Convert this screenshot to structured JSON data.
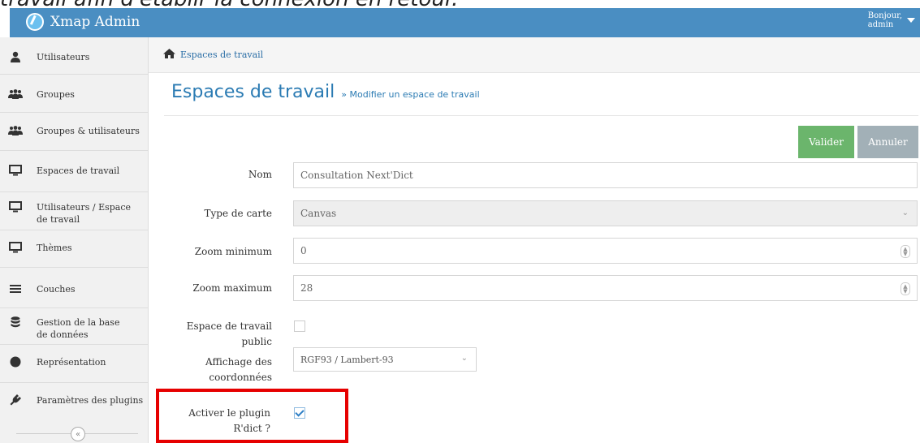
{
  "caption": "travail afin d'établir la connexion en retour.",
  "navbar": {
    "brand": "Xmap Admin",
    "user_greeting": "Bonjour,",
    "user_name": "admin"
  },
  "sidebar": {
    "items": [
      {
        "label": "Utilisateurs",
        "icon": "user-icon"
      },
      {
        "label": "Groupes",
        "icon": "group-icon"
      },
      {
        "label": "Groupes & utilisateurs",
        "icon": "group-icon"
      },
      {
        "label": "Espaces de travail",
        "icon": "monitor-icon"
      },
      {
        "label": "Utilisateurs / Espace de travail",
        "icon": "monitor-icon"
      },
      {
        "label": "Thèmes",
        "icon": "monitor-icon"
      },
      {
        "label": "Couches",
        "icon": "bars-icon"
      },
      {
        "label": "Gestion de la base de données",
        "icon": "database-icon"
      },
      {
        "label": "Représentation",
        "icon": "circle-icon"
      },
      {
        "label": "Paramètres des plugins",
        "icon": "plug-icon"
      }
    ],
    "collapse_symbol": "«"
  },
  "breadcrumb": {
    "label": "Espaces de travail"
  },
  "header": {
    "title": "Espaces de travail",
    "subtitle": "» Modifier un espace de travail"
  },
  "actions": {
    "validate": "Valider",
    "cancel": "Annuler"
  },
  "form": {
    "nom": {
      "label": "Nom",
      "value": "Consultation Next'Dict"
    },
    "type_carte": {
      "label": "Type de carte",
      "value": "Canvas"
    },
    "zoom_min": {
      "label": "Zoom minimum",
      "value": "0"
    },
    "zoom_max": {
      "label": "Zoom maximum",
      "value": "28"
    },
    "public": {
      "label": "Espace de travail public",
      "checked": false
    },
    "coords": {
      "label": "Affichage des coordonnées",
      "value": "RGF93 / Lambert-93"
    },
    "plugin": {
      "label": "Activer le plugin R'dict ?",
      "checked": true
    }
  },
  "colors": {
    "navbar": "#4a8ec2",
    "title": "#2b7bb3",
    "validate": "#6bb56c",
    "cancel": "#a2b0b7",
    "highlight": "#e60000"
  }
}
